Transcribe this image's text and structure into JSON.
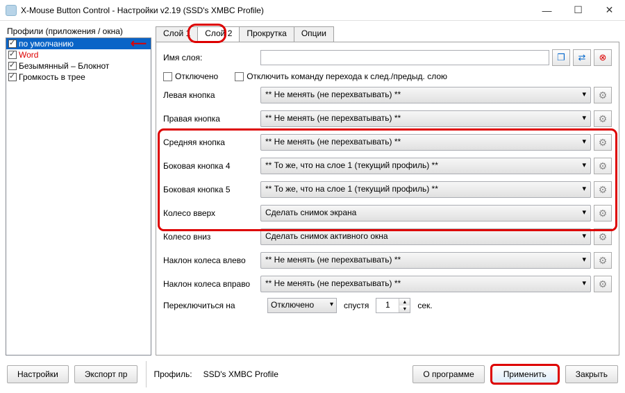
{
  "window": {
    "title": "X-Mouse Button Control - Настройки v2.19 (SSD's XMBC Profile)"
  },
  "profiles_header": "Профили (приложения / окна)",
  "profiles": [
    {
      "name": "по умолчанию",
      "selected": true
    },
    {
      "name": "Word",
      "red": true
    },
    {
      "name": "Безымянный – Блокнот"
    },
    {
      "name": "Громкость в трее"
    }
  ],
  "tabs": [
    "Слой 1",
    "Слой 2",
    "Прокрутка",
    "Опции"
  ],
  "active_tab_index": 1,
  "layer_name_label": "Имя слоя:",
  "disabled_label": "Отключено",
  "disable_switch_label": "Отключить команду перехода к след./предыд. слою",
  "icons": {
    "copy": "❐",
    "swap": "⇄",
    "delete": "⊗",
    "gear": "⚙"
  },
  "buttons": [
    {
      "label": "Левая кнопка",
      "value": "** Не менять (не перехватывать) **"
    },
    {
      "label": "Правая кнопка",
      "value": "** Не менять (не перехватывать) **"
    },
    {
      "label": "Средняя кнопка",
      "value": "** Не менять (не перехватывать) **"
    },
    {
      "label": "Боковая кнопка 4",
      "value": "** То же, что на слое 1 (текущий профиль) **"
    },
    {
      "label": "Боковая кнопка 5",
      "value": "** То же, что на слое 1 (текущий профиль) **"
    },
    {
      "label": "Колесо вверх",
      "value": "Сделать снимок экрана"
    },
    {
      "label": "Колесо вниз",
      "value": "Сделать снимок активного окна"
    },
    {
      "label": "Наклон колеса влево",
      "value": "** Не менять (не перехватывать) **"
    },
    {
      "label": "Наклон колеса вправо",
      "value": "** Не менять (не перехватывать) **"
    }
  ],
  "switch": {
    "label": "Переключиться на",
    "value": "Отключено",
    "after_label": "спустя",
    "count": "1",
    "unit": "сек."
  },
  "footer": {
    "settings": "Настройки",
    "export": "Экспорт пр",
    "profile_label": "Профиль:",
    "profile_value": "SSD's XMBC Profile",
    "about": "О программе",
    "apply": "Применить",
    "close": "Закрыть"
  }
}
